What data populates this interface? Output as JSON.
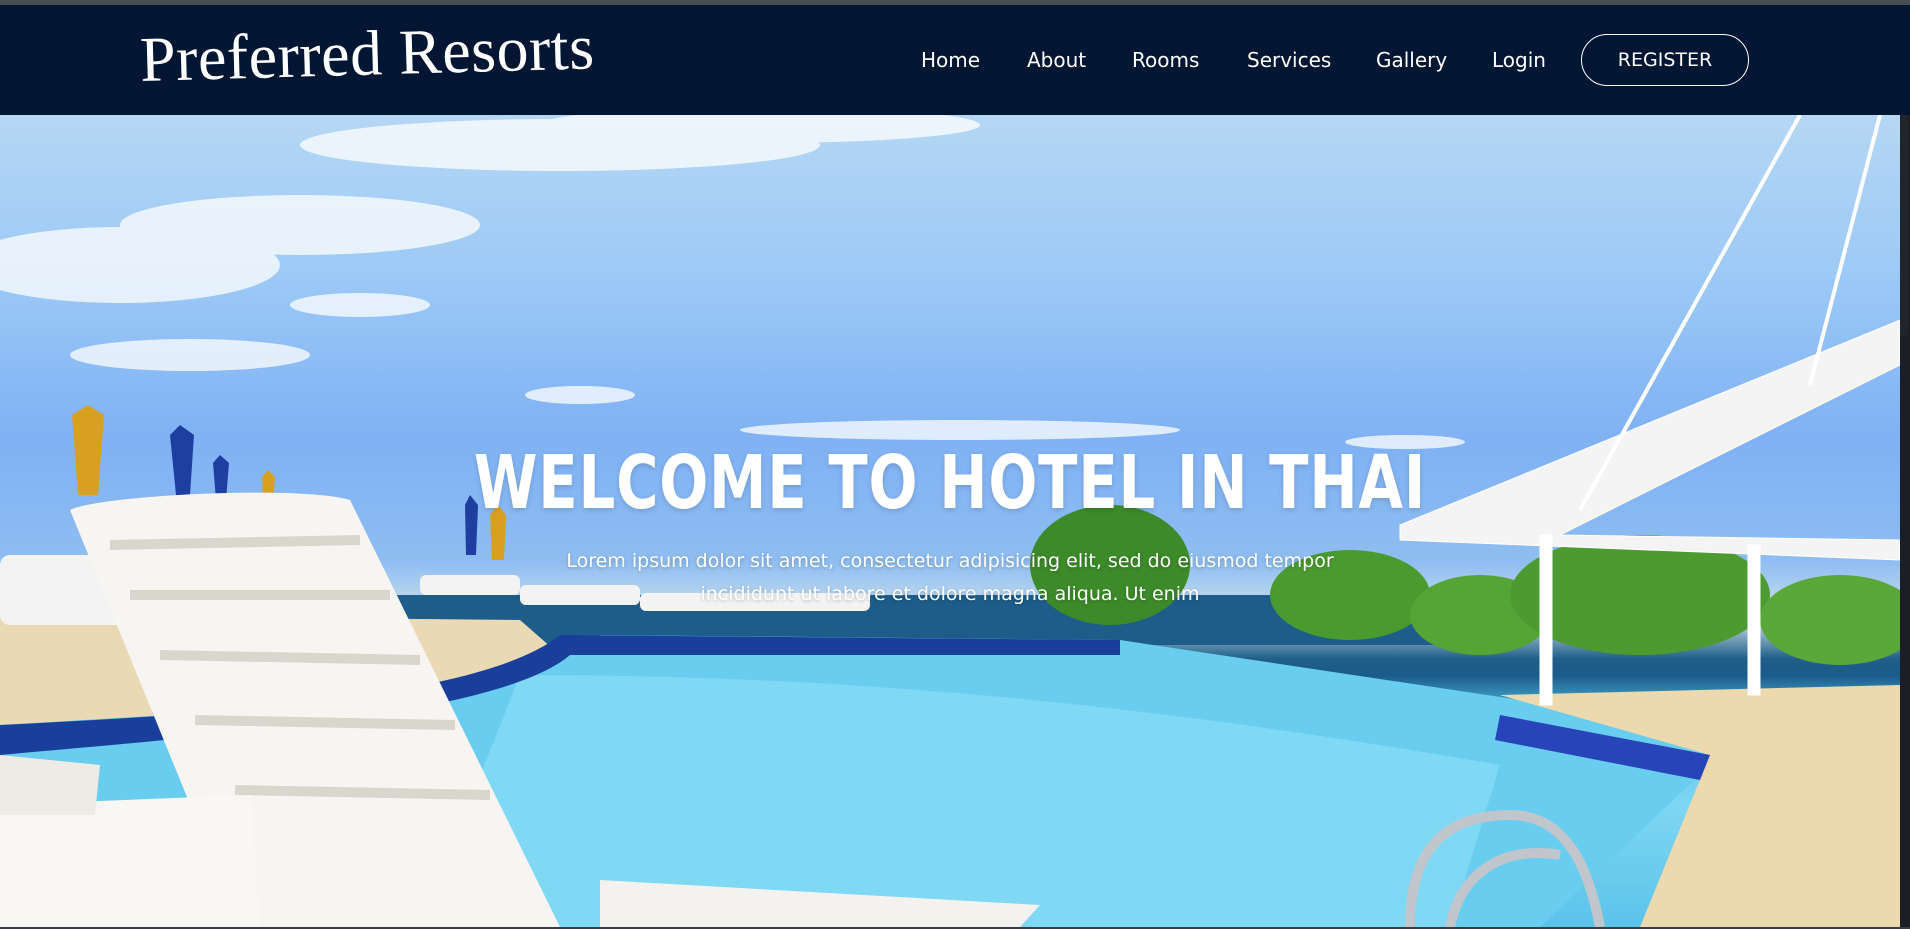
{
  "brand": {
    "logo_text": "Preferred Resorts"
  },
  "nav": {
    "items": [
      {
        "label": "Home"
      },
      {
        "label": "About"
      },
      {
        "label": "Rooms"
      },
      {
        "label": "Services"
      },
      {
        "label": "Gallery"
      },
      {
        "label": "Login"
      }
    ],
    "register_label": "REGISTER"
  },
  "hero": {
    "title": "WELCOME TO HOTEL IN THAI",
    "text": "Lorem ipsum dolor sit amet, consectetur adipisicing elit, sed do eiusmod tempor incididunt ut labore et dolore magna aliqua. Ut enim",
    "image_icon": "resort-pool-photo"
  },
  "colors": {
    "navbar_bg": "#011632",
    "text": "#ffffff"
  }
}
